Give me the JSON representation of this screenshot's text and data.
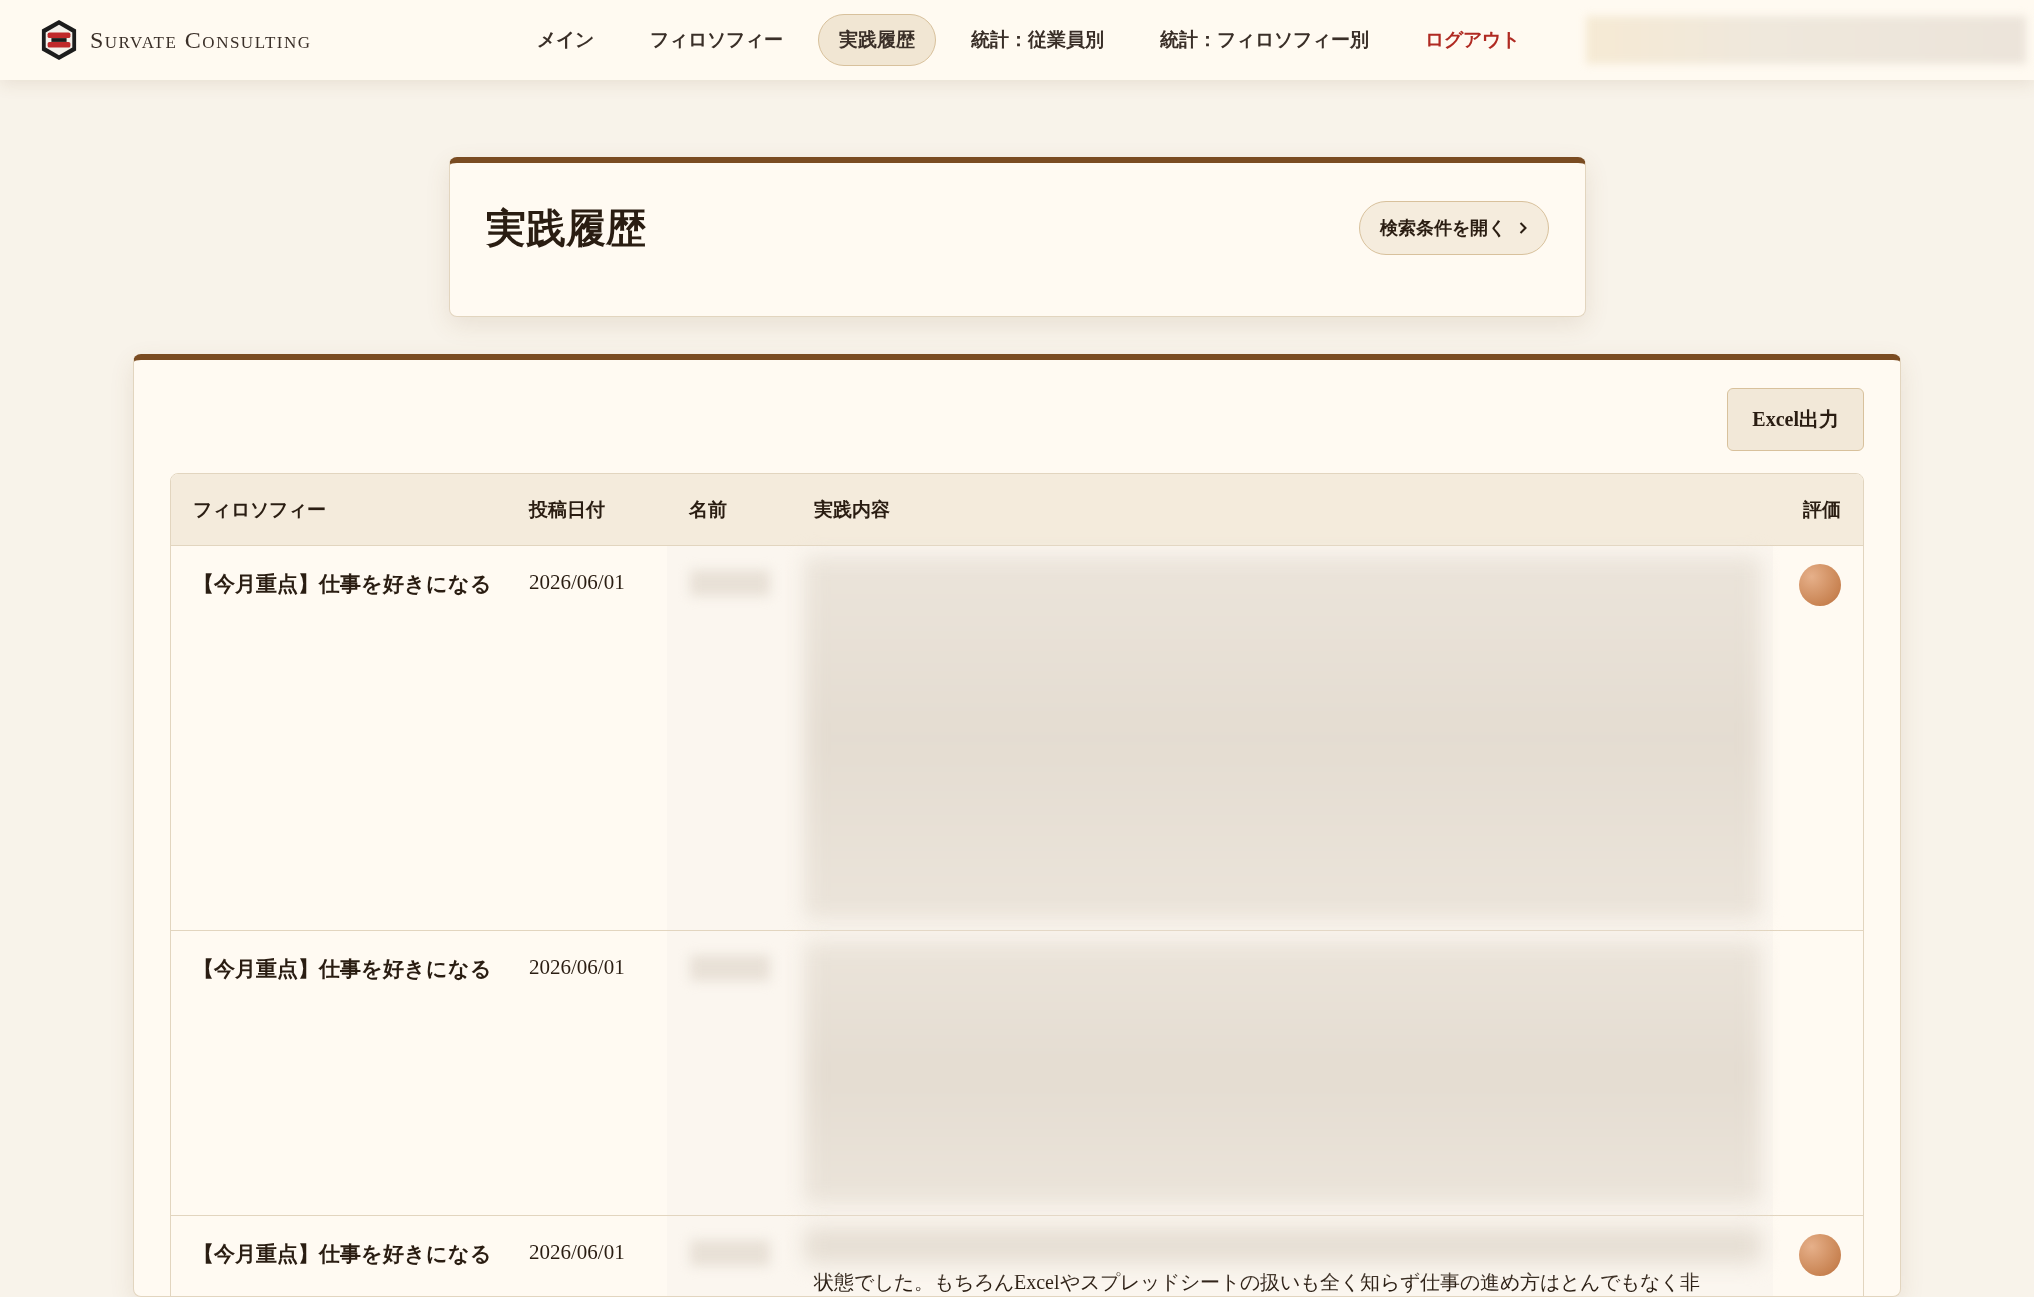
{
  "brand": {
    "name": "Survate Consulting"
  },
  "nav": [
    {
      "label": "メイン",
      "selected": false,
      "kind": "link"
    },
    {
      "label": "フィロソフィー",
      "selected": false,
      "kind": "link"
    },
    {
      "label": "実践履歴",
      "selected": true,
      "kind": "link"
    },
    {
      "label": "統計：従業員別",
      "selected": false,
      "kind": "link"
    },
    {
      "label": "統計：フィロソフィー別",
      "selected": false,
      "kind": "link"
    },
    {
      "label": "ログアウト",
      "selected": false,
      "kind": "logout"
    }
  ],
  "page": {
    "title": "実践履歴",
    "search_toggle": "検索条件を開く"
  },
  "export_button": "Excel出力",
  "table": {
    "columns": [
      "フィロソフィー",
      "投稿日付",
      "名前",
      "実践内容",
      "評価"
    ],
    "rows": [
      {
        "philosophy": "【今月重点】仕事を好きになる",
        "date": "2026/06/01",
        "medal": true
      },
      {
        "philosophy": "【今月重点】仕事を好きになる",
        "date": "2026/06/01",
        "medal": false
      },
      {
        "philosophy": "【今月重点】仕事を好きになる",
        "date": "2026/06/01",
        "medal": true,
        "content": "状態でした。もちろんExcelやスプレッドシートの扱いも全く知らず仕事の進め方はとんでもなく非"
      }
    ]
  }
}
